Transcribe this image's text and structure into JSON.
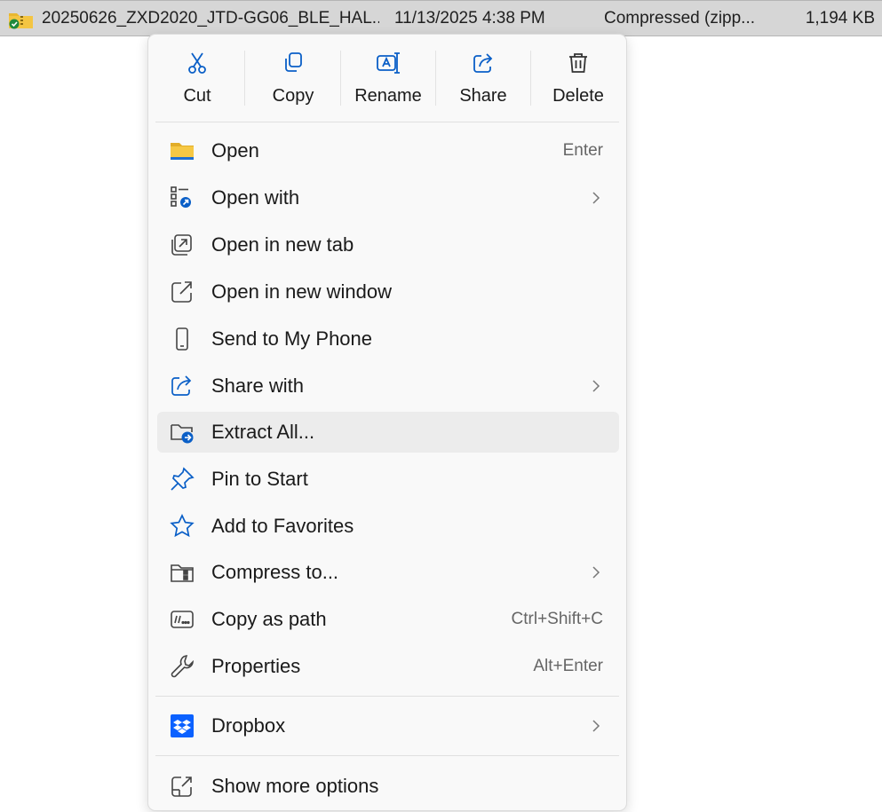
{
  "file_row": {
    "name": "20250626_ZXD2020_JTD-GG06_BLE_HAL...",
    "date_modified": "11/13/2025 4:38 PM",
    "type": "Compressed (zipp...",
    "size": "1,194 KB",
    "icon": "zip-folder-icon"
  },
  "context_menu": {
    "toolbar": [
      {
        "label": "Cut",
        "icon": "scissors-icon"
      },
      {
        "label": "Copy",
        "icon": "copy-icon"
      },
      {
        "label": "Rename",
        "icon": "rename-icon"
      },
      {
        "label": "Share",
        "icon": "share-icon"
      },
      {
        "label": "Delete",
        "icon": "trash-icon"
      }
    ],
    "items": [
      {
        "label": "Open",
        "shortcut": "Enter",
        "icon": "folder-icon"
      },
      {
        "label": "Open with",
        "icon": "open-with-icon",
        "submenu": true
      },
      {
        "label": "Open in new tab",
        "icon": "new-tab-icon"
      },
      {
        "label": "Open in new window",
        "icon": "new-window-icon"
      },
      {
        "label": "Send to My Phone",
        "icon": "phone-icon"
      },
      {
        "label": "Share with",
        "icon": "share-icon",
        "submenu": true
      },
      {
        "label": "Extract All...",
        "icon": "extract-folder-icon",
        "hovered": true
      },
      {
        "label": "Pin to Start",
        "icon": "pin-icon"
      },
      {
        "label": "Add to Favorites",
        "icon": "star-icon"
      },
      {
        "label": "Compress to...",
        "icon": "compress-icon",
        "submenu": true
      },
      {
        "label": "Copy as path",
        "shortcut": "Ctrl+Shift+C",
        "icon": "copy-path-icon"
      },
      {
        "label": "Properties",
        "shortcut": "Alt+Enter",
        "icon": "wrench-icon"
      }
    ],
    "dropbox": {
      "label": "Dropbox",
      "icon": "dropbox-icon",
      "submenu": true
    },
    "more": {
      "label": "Show more options",
      "icon": "show-more-icon"
    },
    "colors": {
      "accent_blue": "#0a5fc7",
      "dropbox_blue": "#0b61ff",
      "folder_yellow": "#f4c542",
      "hover_bg": "#ececec"
    }
  }
}
